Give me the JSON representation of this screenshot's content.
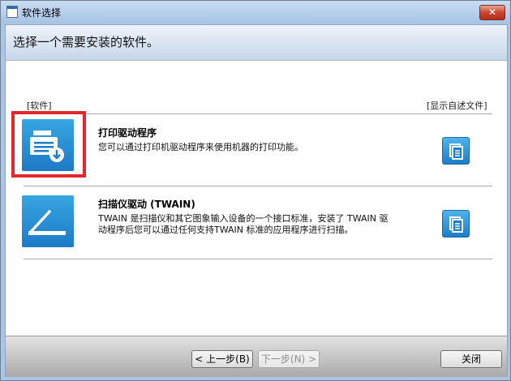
{
  "window": {
    "title": "软件选择",
    "close_label": "✕"
  },
  "banner": {
    "text": "选择一个需要安装的软件。"
  },
  "list": {
    "header_left": "[软件]",
    "header_right": "[显示自述文件]",
    "items": [
      {
        "title": "打印驱动程序",
        "description": "您可以通过打印机驱动程序来使用机器的打印功能。",
        "icon": "printer-icon",
        "selected": true
      },
      {
        "title": "扫描仪驱动 (TWAIN)",
        "description": "TWAIN 是扫描仪和其它图象输入设备的一个接口标准，安装了 TWAIN 驱动程序后您可以通过任何支持TWAIN 标准的应用程序进行扫描。",
        "icon": "scanner-icon",
        "selected": false
      }
    ]
  },
  "footer": {
    "back_label": "< 上一步(B)",
    "next_label": "下一步(N) >",
    "close_label": "关闭"
  },
  "colors": {
    "accent": "#1e86cf",
    "highlight": "#e5262c"
  }
}
